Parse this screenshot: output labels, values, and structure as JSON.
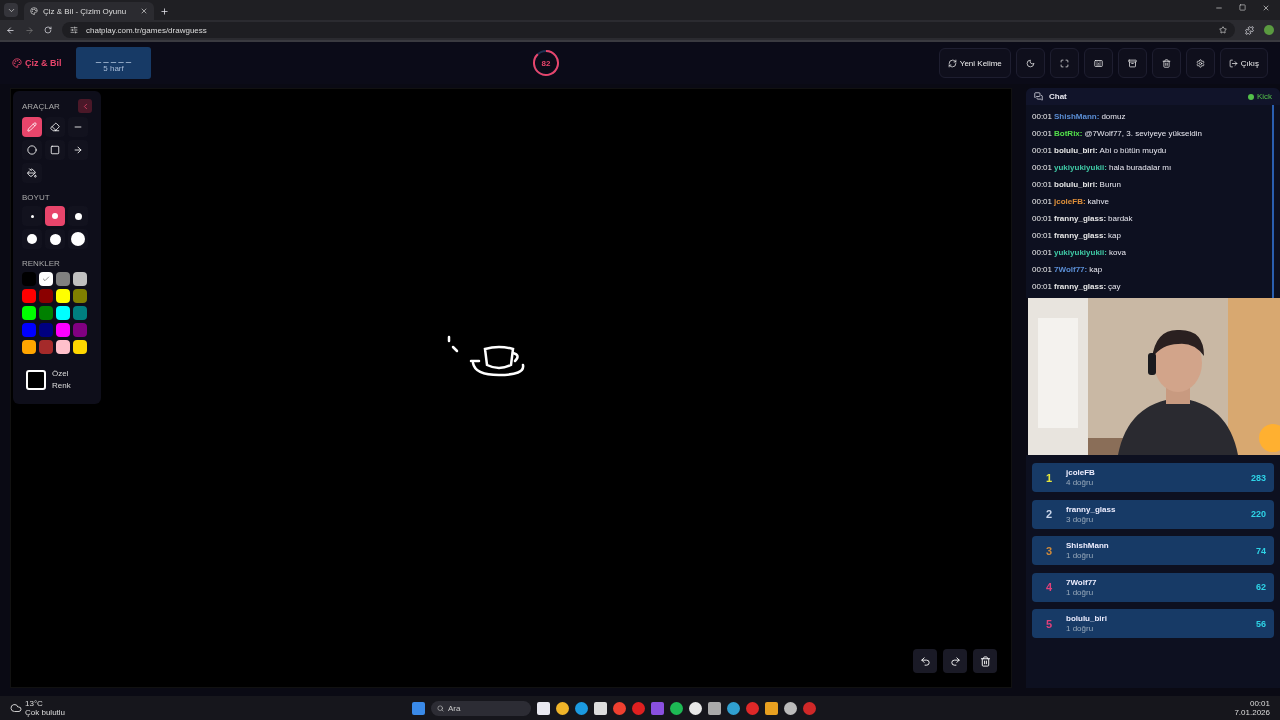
{
  "browser": {
    "tab_title": "Çiz & Bil - Çizim Oyunu",
    "url": "chatplay.com.tr/games/drawguess"
  },
  "header": {
    "logo": "Çiz & Bil",
    "word": {
      "mask": "_ _ _ _ _",
      "hint": "5 harf"
    },
    "timer": {
      "text": "82",
      "level": 0.88
    },
    "actions": [
      {
        "kind": "refresh",
        "label": "Yeni Kelime"
      },
      {
        "kind": "moon"
      },
      {
        "kind": "fullscreen"
      },
      {
        "kind": "keyboard"
      },
      {
        "kind": "archive"
      },
      {
        "kind": "trash"
      },
      {
        "kind": "settings"
      },
      {
        "kind": "logout",
        "label": "Çıkış"
      }
    ]
  },
  "tools": {
    "heading": "ARAÇLAR",
    "items": [
      {
        "kind": "pen",
        "selected": true
      },
      {
        "kind": "eraser",
        "selected": false
      },
      {
        "kind": "line",
        "selected": false
      },
      {
        "kind": "circle",
        "selected": false
      },
      {
        "kind": "square",
        "selected": false
      },
      {
        "kind": "arrow",
        "selected": false
      },
      {
        "kind": "fill",
        "selected": false
      }
    ]
  },
  "sizes": {
    "heading": "BOYUT",
    "items": [
      {
        "selected": false
      },
      {
        "selected": true
      },
      {
        "selected": false
      },
      {
        "selected": false
      },
      {
        "selected": false
      },
      {
        "selected": false
      }
    ]
  },
  "colors": {
    "heading": "RENKLER",
    "items": [
      {
        "color": "#000000",
        "selected": false
      },
      {
        "color": "#ffffff",
        "selected": true
      },
      {
        "color": "#808080",
        "selected": false
      },
      {
        "color": "#c0c0c0",
        "selected": false
      },
      {
        "color": "#ff0000",
        "selected": false
      },
      {
        "color": "#8b0000",
        "selected": false
      },
      {
        "color": "#ffff00",
        "selected": false
      },
      {
        "color": "#808000",
        "selected": false
      },
      {
        "color": "#00ff00",
        "selected": false
      },
      {
        "color": "#008000",
        "selected": false
      },
      {
        "color": "#00ffff",
        "selected": false
      },
      {
        "color": "#008080",
        "selected": false
      },
      {
        "color": "#0000ff",
        "selected": false
      },
      {
        "color": "#000080",
        "selected": false
      },
      {
        "color": "#ff00ff",
        "selected": false
      },
      {
        "color": "#800080",
        "selected": false
      },
      {
        "color": "#ffa500",
        "selected": false
      },
      {
        "color": "#a52a2a",
        "selected": false
      },
      {
        "color": "#ffc0cb",
        "selected": false
      },
      {
        "color": "#ffd700",
        "selected": false
      }
    ],
    "custom_label": "Özel Renk"
  },
  "chat": {
    "title": "Chat",
    "platform": "Kick",
    "messages": [
      {
        "time": "00:01",
        "user": "ShishMann:",
        "color": "#5b8fd6",
        "text": "domuz"
      },
      {
        "time": "00:01",
        "user": "BotRix:",
        "color": "#53e04a",
        "text": "@7Wolf77, 3. seviyeye yükseldin"
      },
      {
        "time": "00:01",
        "user": "bolulu_biri:",
        "color": "#e8e8e8",
        "text": "Abi o bütün muydu"
      },
      {
        "time": "00:01",
        "user": "yukiyukiyukii:",
        "color": "#3fc9a5",
        "text": "hala buradalar mı"
      },
      {
        "time": "00:01",
        "user": "bolulu_biri:",
        "color": "#e8e8e8",
        "text": "Burun"
      },
      {
        "time": "00:01",
        "user": "jcoleFB:",
        "color": "#e0903a",
        "text": "kahve"
      },
      {
        "time": "00:01",
        "user": "franny_glass:",
        "color": "#e8e8e8",
        "text": "bardak"
      },
      {
        "time": "00:01",
        "user": "franny_glass:",
        "color": "#e8e8e8",
        "text": "kap"
      },
      {
        "time": "00:01",
        "user": "yukiyukiyukii:",
        "color": "#3fc9a5",
        "text": "kova"
      },
      {
        "time": "00:01",
        "user": "7Wolf77:",
        "color": "#5b8fd6",
        "text": "kap"
      },
      {
        "time": "00:01",
        "user": "franny_glass:",
        "color": "#e8e8e8",
        "text": "çay"
      }
    ]
  },
  "leaderboard": {
    "rows": [
      {
        "rank": "1",
        "color": "#e6e63c",
        "name": "jcoleFB",
        "correct": "4 doğru",
        "score": "283"
      },
      {
        "rank": "2",
        "color": "#c9d5ea",
        "name": "franny_glass",
        "correct": "3 doğru",
        "score": "220"
      },
      {
        "rank": "3",
        "color": "#d08a3a",
        "name": "ShishMann",
        "correct": "1 doğru",
        "score": "74"
      },
      {
        "rank": "4",
        "color": "#e0407a",
        "name": "7Wolf77",
        "correct": "1 doğru",
        "score": "62"
      },
      {
        "rank": "5",
        "color": "#e0407a",
        "name": "bolulu_biri",
        "correct": "1 doğru",
        "score": "56"
      }
    ]
  },
  "taskbar": {
    "temperature": "13°C",
    "weather": "Çok bulutlu",
    "search_placeholder": "Ara",
    "time": "00:01",
    "date": "7.01.2026"
  }
}
